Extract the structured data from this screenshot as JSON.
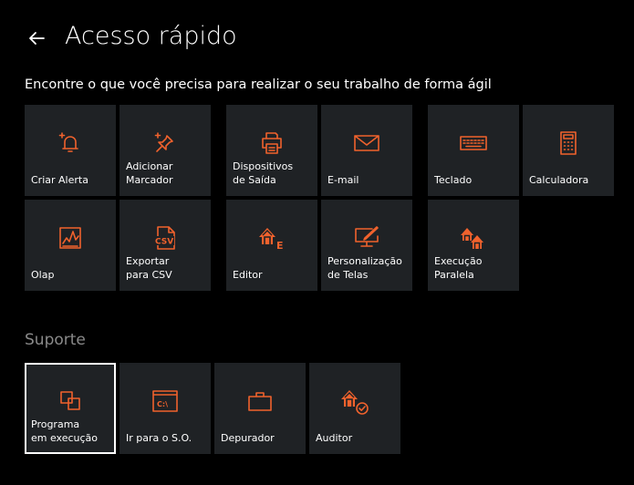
{
  "header": {
    "title": "Acesso rápido",
    "back_icon": "arrow-left-icon"
  },
  "subtitle": "Encontre o que você precisa para realizar o seu trabalho de forma ágil",
  "accent_color": "#f0622d",
  "tile_color": "#1f2225",
  "quick_access": {
    "tiles": [
      {
        "label": "Criar Alerta",
        "icon": "bell-plus-icon"
      },
      {
        "label": "Adicionar\nMarcador",
        "icon": "pin-plus-icon"
      },
      {
        "label": "Dispositivos\nde Saída",
        "icon": "printer-icon"
      },
      {
        "label": "E-mail",
        "icon": "envelope-icon"
      },
      {
        "label": "Teclado",
        "icon": "keyboard-icon"
      },
      {
        "label": "Calculadora",
        "icon": "calculator-icon"
      },
      {
        "label": "Olap",
        "icon": "olap-chart-icon"
      },
      {
        "label": "Exportar\npara CSV",
        "icon": "csv-file-icon"
      },
      {
        "label": "Editor",
        "icon": "house-editor-icon",
        "badge": "E"
      },
      {
        "label": "Personalização\nde Telas",
        "icon": "screen-customize-icon"
      },
      {
        "label": "Execução\nParalela",
        "icon": "parallel-houses-icon"
      }
    ]
  },
  "support": {
    "title": "Suporte",
    "tiles": [
      {
        "label": "Programa\nem execução",
        "icon": "windows-icon",
        "selected": true
      },
      {
        "label": "Ir para o S.O.",
        "icon": "terminal-icon",
        "prompt": "C:\\"
      },
      {
        "label": "Depurador",
        "icon": "briefcase-icon"
      },
      {
        "label": "Auditor",
        "icon": "house-check-icon"
      }
    ]
  }
}
